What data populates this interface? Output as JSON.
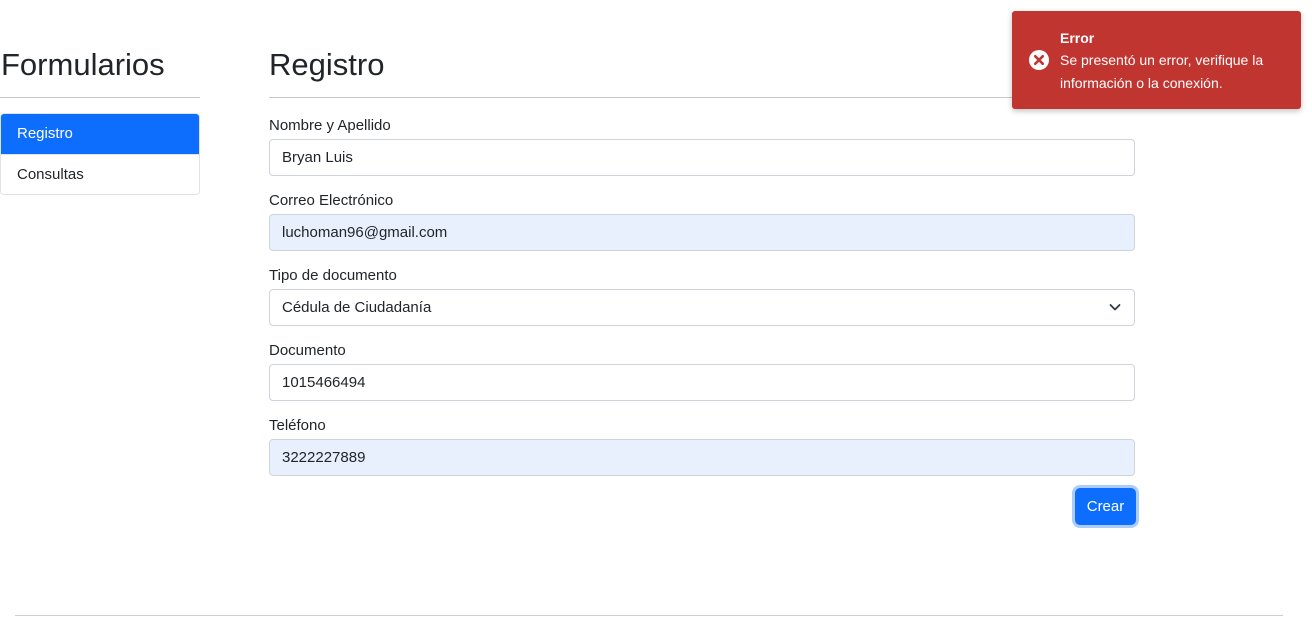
{
  "sidebar": {
    "title": "Formularios",
    "items": [
      {
        "label": "Registro",
        "active": true
      },
      {
        "label": "Consultas",
        "active": false
      }
    ]
  },
  "main": {
    "title": "Registro",
    "fields": {
      "name": {
        "label": "Nombre y Apellido",
        "value": "Bryan Luis"
      },
      "email": {
        "label": "Correo Electrónico",
        "value": "luchoman96@gmail.com"
      },
      "doc_type": {
        "label": "Tipo de documento",
        "value": "Cédula de Ciudadanía"
      },
      "document": {
        "label": "Documento",
        "value": "1015466494"
      },
      "phone": {
        "label": "Teléfono",
        "value": "3222227889"
      }
    },
    "submit_label": "Crear"
  },
  "toast": {
    "title": "Error",
    "message": "Se presentó un error, verifique la información o la conexión.",
    "icon": "error-circle-icon",
    "color": "#c13531"
  },
  "colors": {
    "primary": "#0d6efd",
    "autofill": "#e8f0fe"
  }
}
